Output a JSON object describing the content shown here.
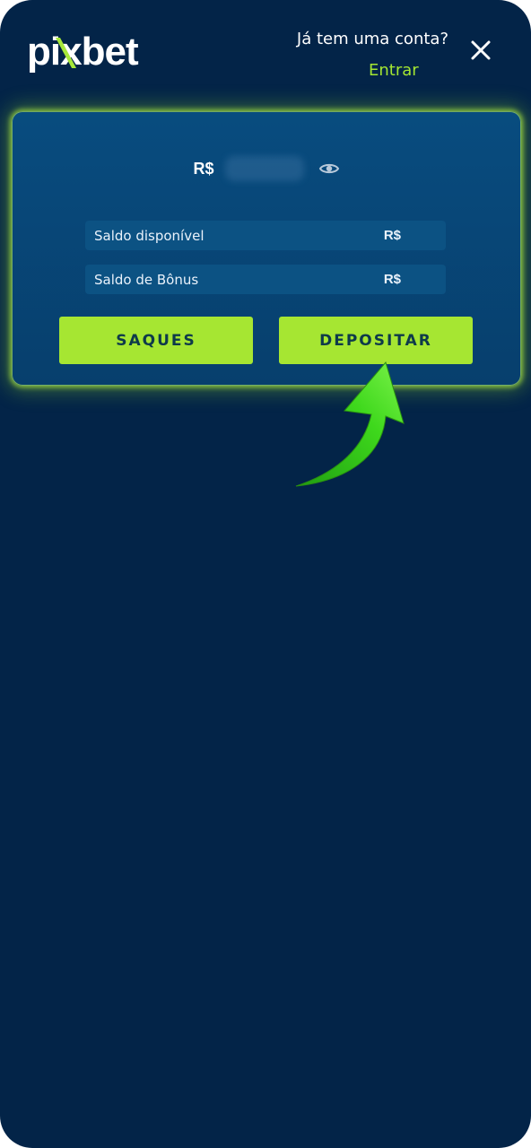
{
  "header": {
    "logo_text": "pixbet",
    "login_question": "Já tem uma conta?",
    "login_link": "Entrar",
    "close_icon": "close-icon"
  },
  "balance": {
    "currency": "R$",
    "amount_hidden": true,
    "visibility_icon": "eye-icon",
    "rows": [
      {
        "label": "Saldo disponível",
        "currency": "R$"
      },
      {
        "label": "Saldo de Bônus",
        "currency": "R$"
      }
    ]
  },
  "actions": {
    "withdraw_label": "SAQUES",
    "deposit_label": "DEPOSITAR"
  },
  "colors": {
    "background": "#032448",
    "card": "#084c7f",
    "accent": "#a6e632"
  }
}
